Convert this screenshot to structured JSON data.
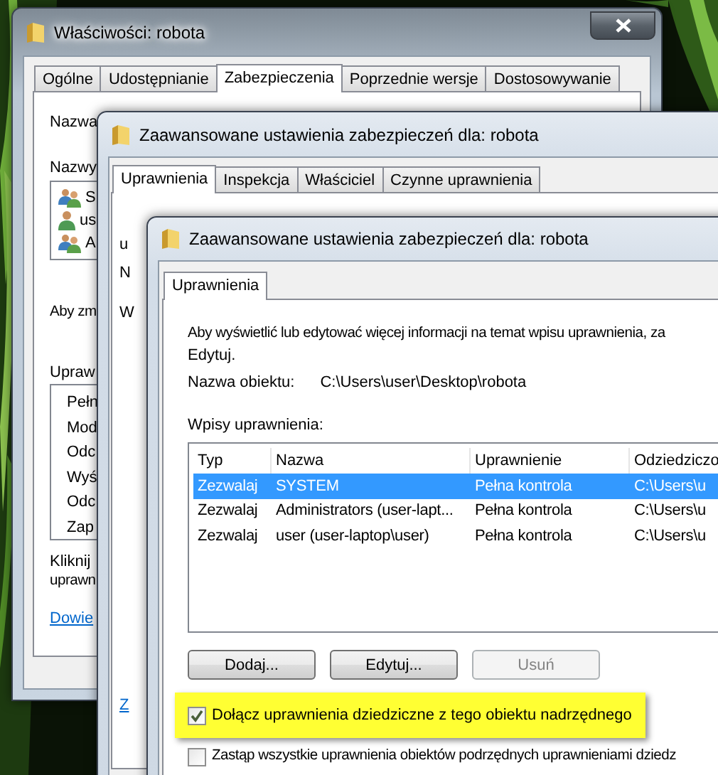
{
  "properties_window": {
    "title": "Właściwości: robota",
    "tabs": [
      {
        "label": "Ogólne",
        "selected": false
      },
      {
        "label": "Udostępnianie",
        "selected": false
      },
      {
        "label": "Zabezpieczenia",
        "selected": true
      },
      {
        "label": "Poprzednie wersje",
        "selected": false
      },
      {
        "label": "Dostosowywanie",
        "selected": false
      }
    ],
    "object_label": "Nazwa",
    "groups_label": "Nazwy",
    "groups": [
      {
        "name": "S",
        "kind": "group"
      },
      {
        "name": "us",
        "kind": "user"
      },
      {
        "name": "A",
        "kind": "group"
      }
    ],
    "change_hint": "Aby zm",
    "permissions_label": "Upraw",
    "permissions": [
      "Pełn",
      "Mod",
      "Odc",
      "Wyś",
      "Odc",
      "Zap"
    ],
    "advanced_hint": [
      "Kliknij",
      "uprawn"
    ],
    "link": "Dowie"
  },
  "advanced_window": {
    "title": "Zaawansowane ustawienia zabezpieczeń dla: robota",
    "tabs": [
      {
        "label": "Uprawnienia",
        "selected": true
      },
      {
        "label": "Inspekcja",
        "selected": false
      },
      {
        "label": "Właściciel",
        "selected": false
      },
      {
        "label": "Czynne uprawnienia",
        "selected": false
      }
    ],
    "intro": "u",
    "object_label": "N",
    "entries_label": "W",
    "link": "Z"
  },
  "front_window": {
    "title": "Zaawansowane ustawienia zabezpieczeń dla: robota",
    "tabs": [
      {
        "label": "Uprawnienia",
        "selected": true
      }
    ],
    "intro": [
      "Aby wyświetlić lub edytować więcej informacji na temat wpisu uprawnienia, za",
      "Edytuj."
    ],
    "object_label": "Nazwa obiektu:",
    "object_path": "C:\\Users\\user\\Desktop\\robota",
    "entries_label": "Wpisy uprawnienia:",
    "table": {
      "columns": [
        "Typ",
        "Nazwa",
        "Uprawnienie",
        "Odziedziczo"
      ],
      "rows": [
        {
          "cells": [
            "Zezwalaj",
            "SYSTEM",
            "Pełna kontrola",
            "C:\\Users\\u"
          ],
          "selected": true
        },
        {
          "cells": [
            "Zezwalaj",
            "Administrators (user-lapt...",
            "Pełna kontrola",
            "C:\\Users\\u"
          ],
          "selected": false
        },
        {
          "cells": [
            "Zezwalaj",
            "user (user-laptop\\user)",
            "Pełna kontrola",
            "C:\\Users\\u"
          ],
          "selected": false
        }
      ]
    },
    "buttons": [
      {
        "label": "Dodaj...",
        "disabled": false
      },
      {
        "label": "Edytuj...",
        "disabled": false
      },
      {
        "label": "Usuń",
        "disabled": true
      }
    ],
    "options": [
      {
        "label": "Dołącz uprawnienia dziedziczne z tego obiektu nadrzędnego",
        "checked": true,
        "highlighted": true
      },
      {
        "label": "Zastąp wszystkie uprawnienia obiektów podrzędnych uprawnieniami dziedz",
        "checked": false,
        "highlighted": false
      }
    ]
  }
}
